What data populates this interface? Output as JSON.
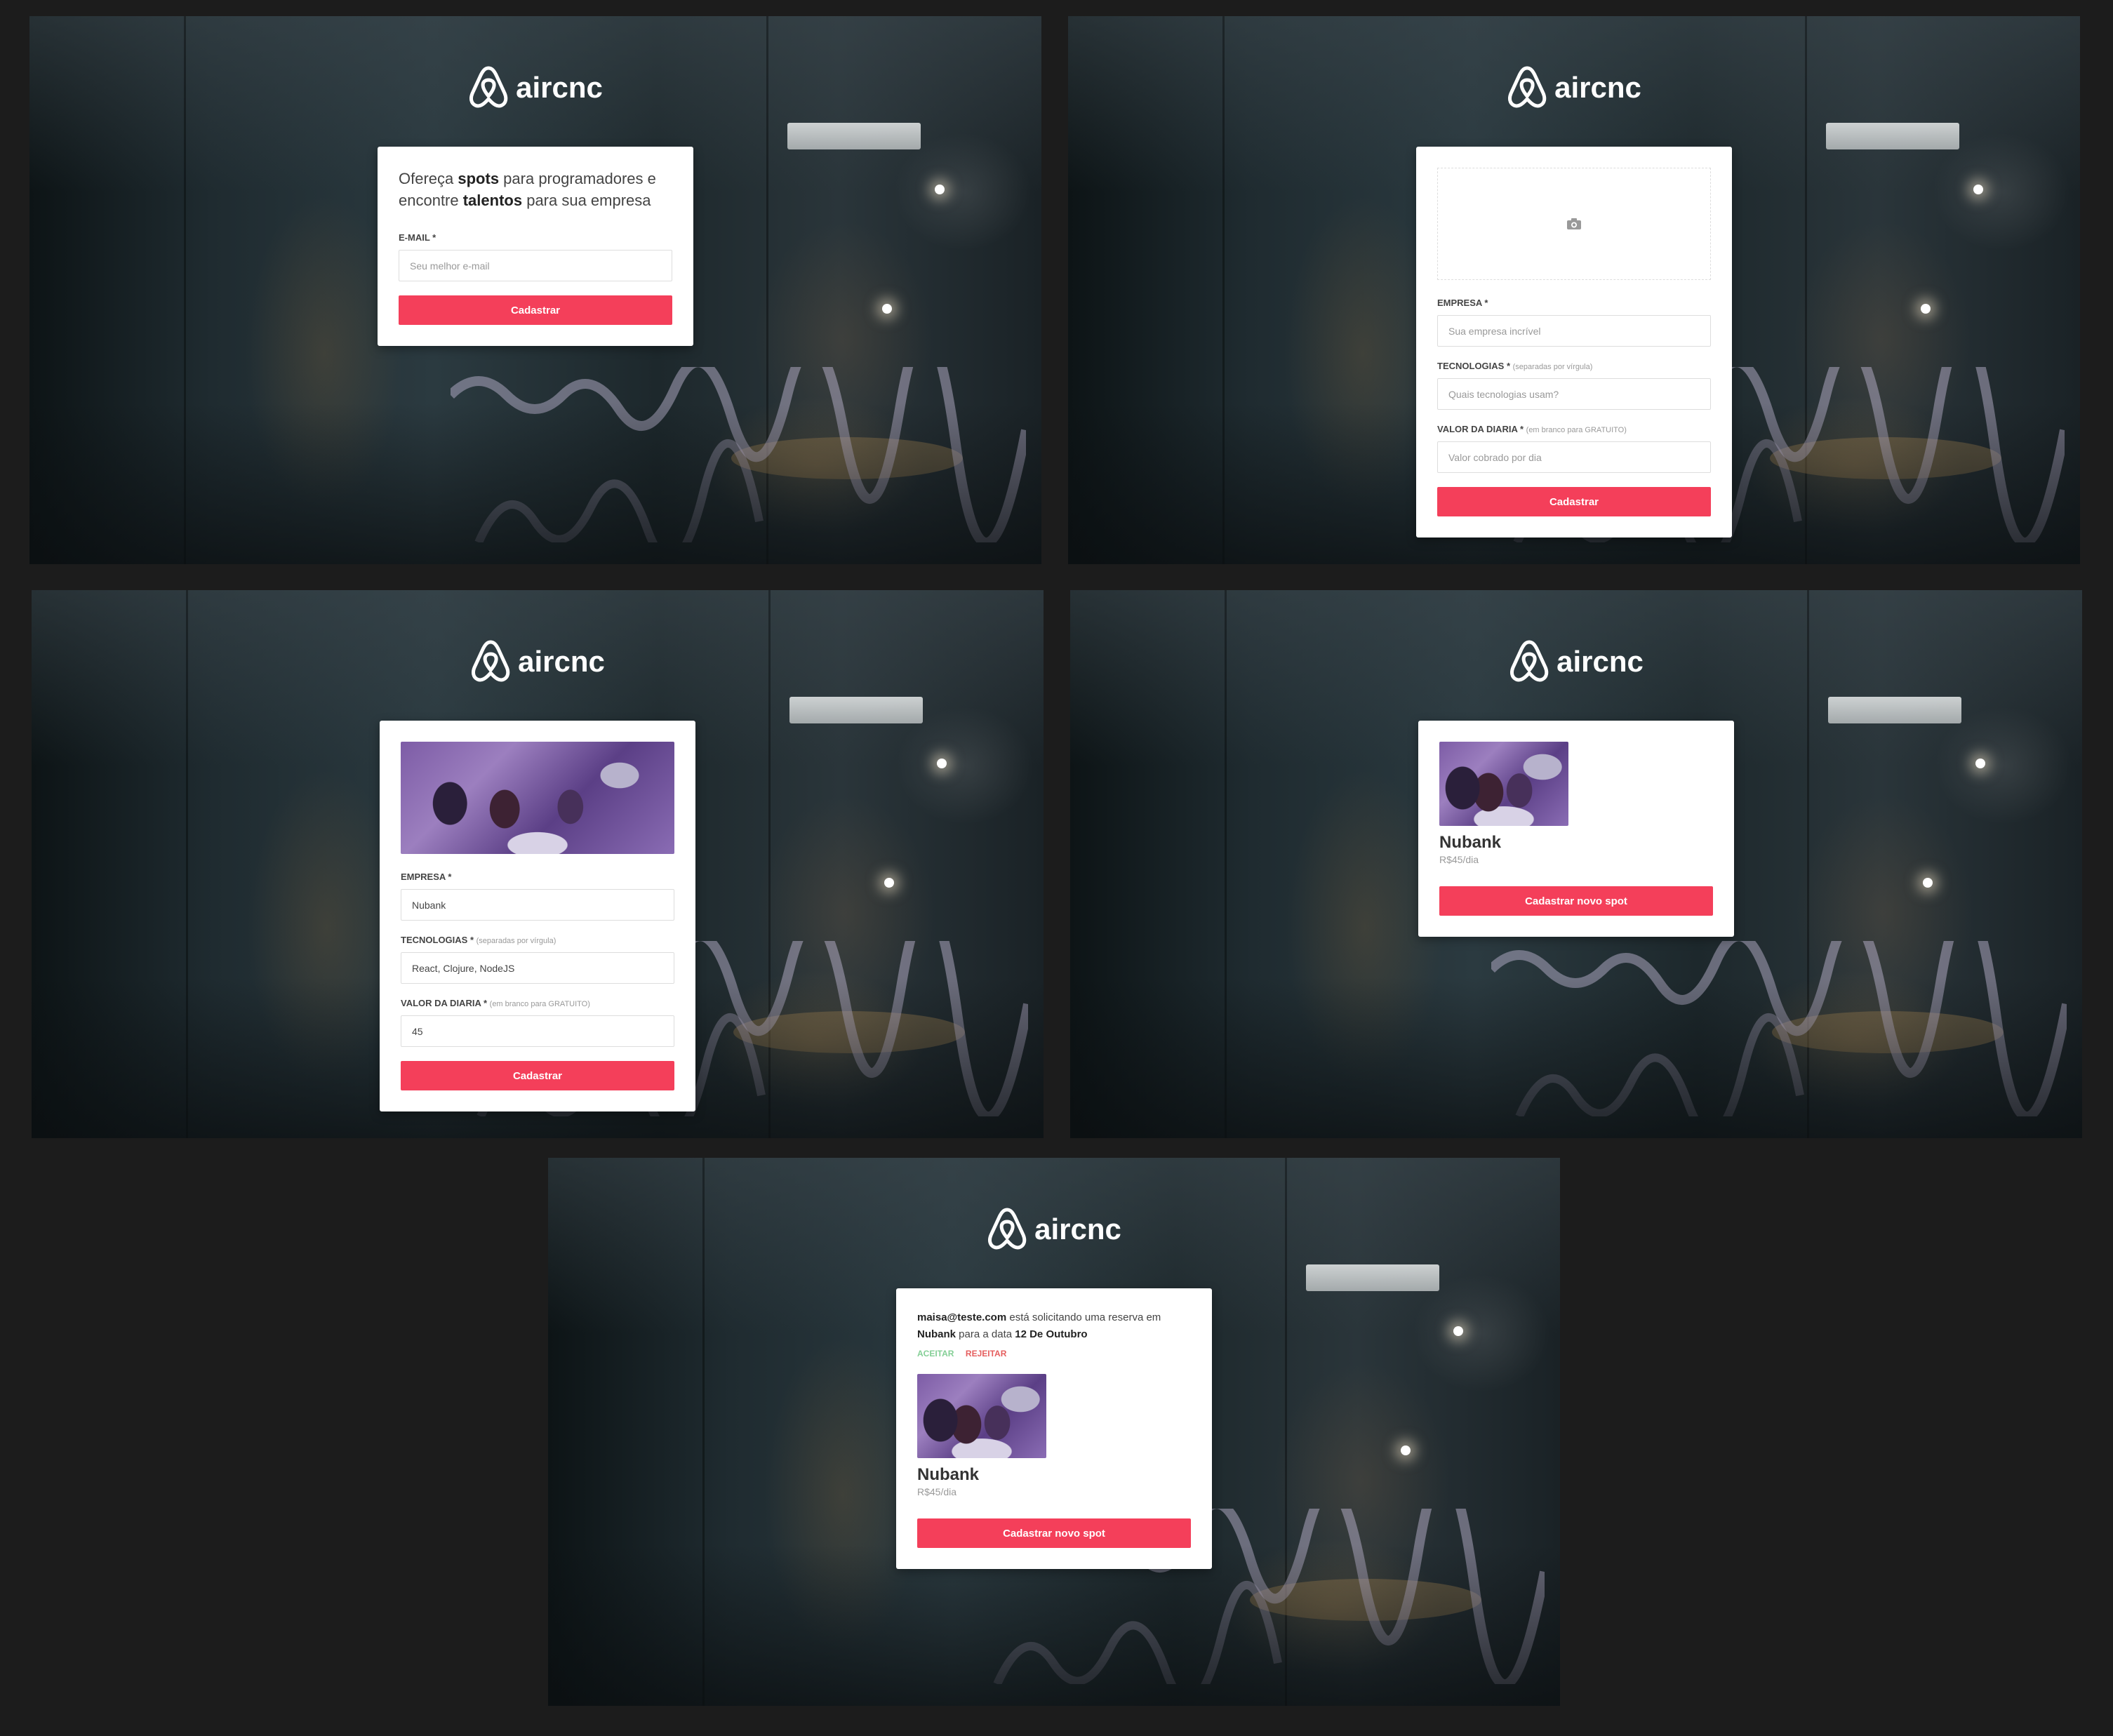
{
  "brand": {
    "name": "aircnc",
    "accent": "#f43f5a"
  },
  "screens": {
    "login": {
      "intro_pre": "Ofereça ",
      "intro_b1": "spots",
      "intro_mid": " para programadores e encontre ",
      "intro_b2": "talentos",
      "intro_post": " para sua empresa",
      "email_label": "E-MAIL *",
      "email_placeholder": "Seu melhor e-mail",
      "submit": "Cadastrar"
    },
    "new_empty": {
      "thumbnail_icon": "camera-icon",
      "company_label": "EMPRESA *",
      "company_placeholder": "Sua empresa incrível",
      "techs_label": "TECNOLOGIAS *",
      "techs_hint": "(separadas por vírgula)",
      "techs_placeholder": "Quais tecnologias usam?",
      "price_label": "VALOR DA DIARIA *",
      "price_hint": "(em branco para GRATUITO)",
      "price_placeholder": "Valor cobrado por dia",
      "submit": "Cadastrar"
    },
    "new_filled": {
      "company_label": "EMPRESA *",
      "company_value": "Nubank",
      "techs_label": "TECNOLOGIAS *",
      "techs_hint": "(separadas por vírgula)",
      "techs_value": "React, Clojure, NodeJS",
      "price_label": "VALOR DA DIARIA *",
      "price_hint": "(em branco para GRATUITO)",
      "price_value": "45",
      "submit": "Cadastrar"
    },
    "dashboard": {
      "spot_name": "Nubank",
      "spot_price": "R$45/dia",
      "new_spot": "Cadastrar novo spot"
    },
    "dashboard_request": {
      "user": "maisa@teste.com",
      "msg1": " está solicitando uma reserva em ",
      "company": "Nubank",
      "msg2": " para a data ",
      "date": "12 De Outubro",
      "accept": "ACEITAR",
      "reject": "REJEITAR",
      "spot_name": "Nubank",
      "spot_price": "R$45/dia",
      "new_spot": "Cadastrar novo spot"
    }
  }
}
